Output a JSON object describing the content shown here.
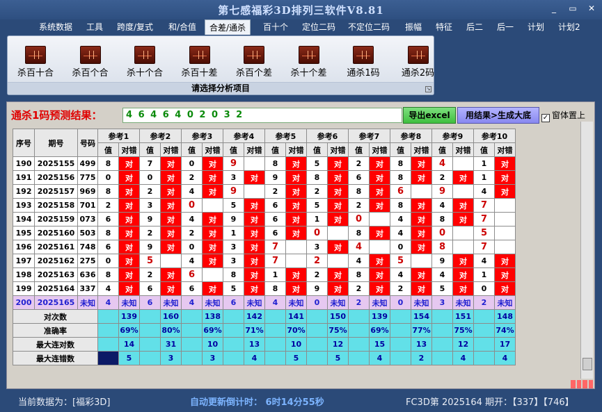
{
  "window": {
    "title": "第七感福彩3D排列三软件V8.81",
    "minimize": "_",
    "restore": "▭",
    "close": "✕"
  },
  "menu": [
    "系统数据",
    "工具",
    "跨度/复式",
    "和/合值",
    "合差/通杀",
    "百十个",
    "定位二码",
    "不定位二码",
    "振幅",
    "特征",
    "后二",
    "后一",
    "计划",
    "计划2"
  ],
  "menu_active_index": 4,
  "ribbon": {
    "buttons": [
      "杀百十合",
      "杀百个合",
      "杀十个合",
      "杀百十差",
      "杀百个差",
      "杀十个差",
      "通杀1码",
      "通杀2码"
    ],
    "caption": "请选择分析项目"
  },
  "prediction": {
    "title": "通杀1码预测结果：",
    "value": "4 6 4 6 4 0 2 0 3 2",
    "export_button": "导出excel",
    "generate_button": "用结果>生成大底",
    "topmost_label": "窗体置上",
    "topmost_checked": "✓"
  },
  "table": {
    "col_seq": "序号",
    "col_period": "期号",
    "col_number": "号码",
    "ref_headers": [
      "参考1",
      "参考2",
      "参考3",
      "参考4",
      "参考5",
      "参考6",
      "参考7",
      "参考8",
      "参考9",
      "参考10"
    ],
    "sub_value": "值",
    "sub_result": "对错",
    "hit_text": "对",
    "rows": [
      {
        "seq": "190",
        "period": "2025155",
        "number": "499",
        "refs": [
          [
            "8",
            1
          ],
          [
            "7",
            1
          ],
          [
            "0",
            1
          ],
          [
            "9",
            0
          ],
          [
            "8",
            1
          ],
          [
            "5",
            1
          ],
          [
            "2",
            1
          ],
          [
            "8",
            1
          ],
          [
            "4",
            0
          ],
          [
            "1",
            1
          ]
        ],
        "red": [
          3,
          8
        ]
      },
      {
        "seq": "191",
        "period": "2025156",
        "number": "775",
        "refs": [
          [
            "0",
            1
          ],
          [
            "0",
            1
          ],
          [
            "2",
            1
          ],
          [
            "3",
            1
          ],
          [
            "9",
            1
          ],
          [
            "8",
            1
          ],
          [
            "6",
            1
          ],
          [
            "8",
            1
          ],
          [
            "2",
            1
          ],
          [
            "1",
            1
          ]
        ],
        "red": []
      },
      {
        "seq": "192",
        "period": "2025157",
        "number": "969",
        "refs": [
          [
            "8",
            1
          ],
          [
            "2",
            1
          ],
          [
            "4",
            1
          ],
          [
            "9",
            0
          ],
          [
            "2",
            1
          ],
          [
            "2",
            1
          ],
          [
            "8",
            1
          ],
          [
            "6",
            0
          ],
          [
            "9",
            0
          ],
          [
            "4",
            1
          ]
        ],
        "red": [
          3,
          7,
          8
        ]
      },
      {
        "seq": "193",
        "period": "2025158",
        "number": "701",
        "refs": [
          [
            "2",
            1
          ],
          [
            "3",
            1
          ],
          [
            "0",
            0
          ],
          [
            "5",
            1
          ],
          [
            "6",
            1
          ],
          [
            "5",
            1
          ],
          [
            "2",
            1
          ],
          [
            "8",
            1
          ],
          [
            "4",
            1
          ],
          [
            "7",
            0
          ]
        ],
        "red": [
          2,
          9
        ]
      },
      {
        "seq": "194",
        "period": "2025159",
        "number": "073",
        "refs": [
          [
            "6",
            1
          ],
          [
            "9",
            1
          ],
          [
            "4",
            1
          ],
          [
            "9",
            1
          ],
          [
            "6",
            1
          ],
          [
            "1",
            1
          ],
          [
            "0",
            0
          ],
          [
            "4",
            1
          ],
          [
            "8",
            1
          ],
          [
            "7",
            0
          ]
        ],
        "red": [
          6,
          9
        ]
      },
      {
        "seq": "195",
        "period": "2025160",
        "number": "503",
        "refs": [
          [
            "8",
            1
          ],
          [
            "2",
            1
          ],
          [
            "2",
            1
          ],
          [
            "1",
            1
          ],
          [
            "6",
            1
          ],
          [
            "0",
            0
          ],
          [
            "8",
            1
          ],
          [
            "4",
            1
          ],
          [
            "0",
            0
          ],
          [
            "5",
            0
          ]
        ],
        "red": [
          5,
          8,
          9
        ]
      },
      {
        "seq": "196",
        "period": "2025161",
        "number": "748",
        "refs": [
          [
            "6",
            1
          ],
          [
            "9",
            1
          ],
          [
            "0",
            1
          ],
          [
            "3",
            1
          ],
          [
            "7",
            0
          ],
          [
            "3",
            1
          ],
          [
            "4",
            0
          ],
          [
            "0",
            1
          ],
          [
            "8",
            0
          ],
          [
            "7",
            0
          ]
        ],
        "red": [
          4,
          6,
          8,
          9
        ]
      },
      {
        "seq": "197",
        "period": "2025162",
        "number": "275",
        "refs": [
          [
            "0",
            1
          ],
          [
            "5",
            0
          ],
          [
            "4",
            1
          ],
          [
            "3",
            1
          ],
          [
            "7",
            0
          ],
          [
            "2",
            0
          ],
          [
            "4",
            1
          ],
          [
            "5",
            0
          ],
          [
            "9",
            1
          ],
          [
            "4",
            1
          ]
        ],
        "red": [
          1,
          4,
          5,
          7
        ]
      },
      {
        "seq": "198",
        "period": "2025163",
        "number": "636",
        "refs": [
          [
            "8",
            1
          ],
          [
            "2",
            1
          ],
          [
            "6",
            0
          ],
          [
            "8",
            1
          ],
          [
            "1",
            1
          ],
          [
            "2",
            1
          ],
          [
            "8",
            1
          ],
          [
            "4",
            1
          ],
          [
            "4",
            1
          ],
          [
            "1",
            1
          ]
        ],
        "red": [
          2
        ]
      },
      {
        "seq": "199",
        "period": "2025164",
        "number": "337",
        "refs": [
          [
            "4",
            1
          ],
          [
            "6",
            1
          ],
          [
            "6",
            1
          ],
          [
            "5",
            1
          ],
          [
            "8",
            1
          ],
          [
            "9",
            1
          ],
          [
            "2",
            1
          ],
          [
            "2",
            1
          ],
          [
            "5",
            1
          ],
          [
            "0",
            1
          ]
        ],
        "red": []
      }
    ],
    "predict_row": {
      "seq": "200",
      "period": "2025165",
      "number": "未知",
      "values": [
        "4",
        "6",
        "4",
        "6",
        "4",
        "0",
        "2",
        "0",
        "3",
        "2"
      ],
      "unknown": "未知"
    },
    "stats": [
      {
        "label": "对次数",
        "values": [
          "139",
          "160",
          "138",
          "142",
          "141",
          "150",
          "139",
          "154",
          "151",
          "148"
        ]
      },
      {
        "label": "准确率",
        "values": [
          "69%",
          "80%",
          "69%",
          "71%",
          "70%",
          "75%",
          "69%",
          "77%",
          "75%",
          "74%"
        ]
      },
      {
        "label": "最大连对数",
        "values": [
          "14",
          "31",
          "10",
          "13",
          "10",
          "12",
          "15",
          "13",
          "12",
          "17"
        ]
      },
      {
        "label": "最大连错数",
        "values": [
          "5",
          "3",
          "3",
          "4",
          "5",
          "5",
          "4",
          "2",
          "4",
          "4"
        ]
      }
    ]
  },
  "status": {
    "left": "当前数据为：[福彩3D]",
    "countdown": "自动更新倒计时： 6时14分55秒",
    "right": "FC3D第 2025164 期开：【337】【746】"
  },
  "colors": {
    "hit": "#ff0000",
    "stat": "#62e0e8",
    "predict": "#e6c8f0"
  }
}
